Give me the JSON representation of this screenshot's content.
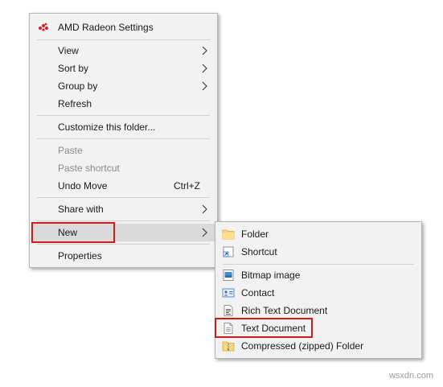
{
  "context_menu": {
    "header_item": {
      "label": "AMD Radeon Settings",
      "icon": "amd-radeon-icon",
      "icon_color": "#d0242b"
    },
    "items": [
      {
        "label": "View",
        "submenu": true
      },
      {
        "label": "Sort by",
        "submenu": true
      },
      {
        "label": "Group by",
        "submenu": true
      },
      {
        "label": "Refresh"
      },
      {
        "label": "Customize this folder..."
      },
      {
        "label": "Paste",
        "disabled": true
      },
      {
        "label": "Paste shortcut",
        "disabled": true
      },
      {
        "label": "Undo Move",
        "shortcut": "Ctrl+Z"
      },
      {
        "label": "Share with",
        "submenu": true
      },
      {
        "label": "New",
        "submenu": true,
        "highlighted": true
      },
      {
        "label": "Properties"
      }
    ]
  },
  "new_submenu": {
    "items": [
      {
        "label": "Folder",
        "icon": "folder-icon"
      },
      {
        "label": "Shortcut",
        "icon": "shortcut-icon"
      },
      {
        "label": "Bitmap image",
        "icon": "bitmap-image-icon"
      },
      {
        "label": "Contact",
        "icon": "contact-icon"
      },
      {
        "label": "Rich Text Document",
        "icon": "rich-text-document-icon"
      },
      {
        "label": "Text Document",
        "icon": "text-document-icon",
        "highlighted": true
      },
      {
        "label": "Compressed (zipped) Folder",
        "icon": "zip-folder-icon"
      }
    ]
  },
  "annotation_color": "#d11a1a",
  "watermark": "wsxdn.com"
}
